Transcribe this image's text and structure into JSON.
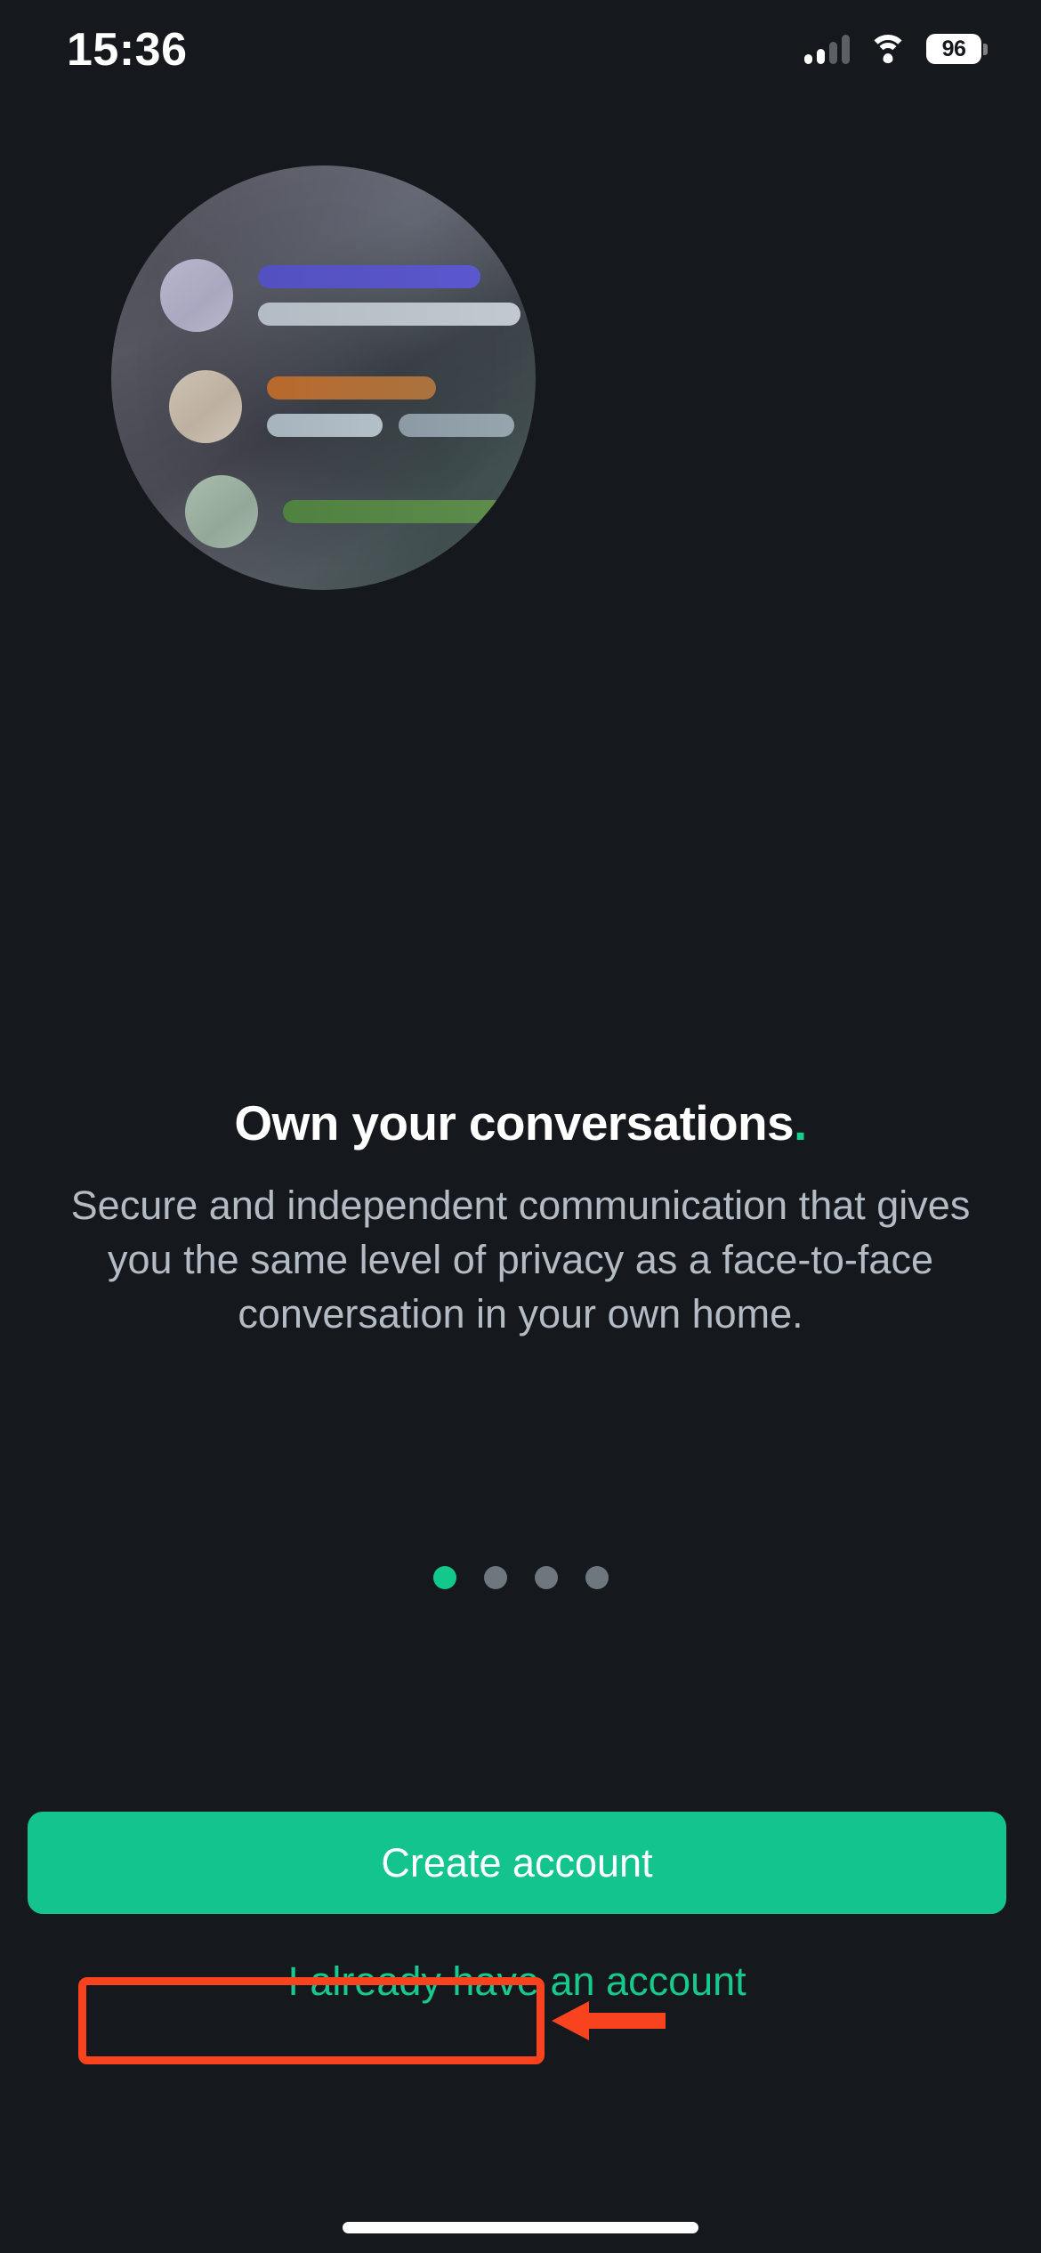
{
  "status_bar": {
    "time": "15:36",
    "battery_level": "96",
    "signal_icon": "cellular-signal-icon",
    "wifi_icon": "wifi-icon",
    "battery_icon": "battery-icon"
  },
  "illustration": {
    "name": "conversation-illustration",
    "rows": [
      {
        "avatar_color": "#b7b6cb",
        "bar_primary_color": "#5350c0",
        "bar_secondary_color": "#b3bcc4"
      },
      {
        "avatar_color": "#cdc2b0",
        "bar_primary_color": "#b9692c",
        "bar_secondary_color": "#a7b3bd"
      },
      {
        "avatar_color": "#a9bdaf",
        "bar_primary_color": "#4f8140",
        "typing_indicator": true
      }
    ]
  },
  "content": {
    "headline": "Own your conversations",
    "headline_accent": ".",
    "body": "Secure and independent communication that gives you the same level of privacy as a face-to-face conversation in your own home."
  },
  "pagination": {
    "total": 4,
    "active_index": 0,
    "active_color": "#12c98b",
    "inactive_color": "#6e767e"
  },
  "actions": {
    "primary_label": "Create account",
    "primary_bg": "#13c48f",
    "primary_text_color": "#ffffff",
    "secondary_label": "I already have an account",
    "secondary_text_color": "#18c98c"
  },
  "annotation": {
    "color": "#f8431e",
    "target": "I already have an account"
  }
}
